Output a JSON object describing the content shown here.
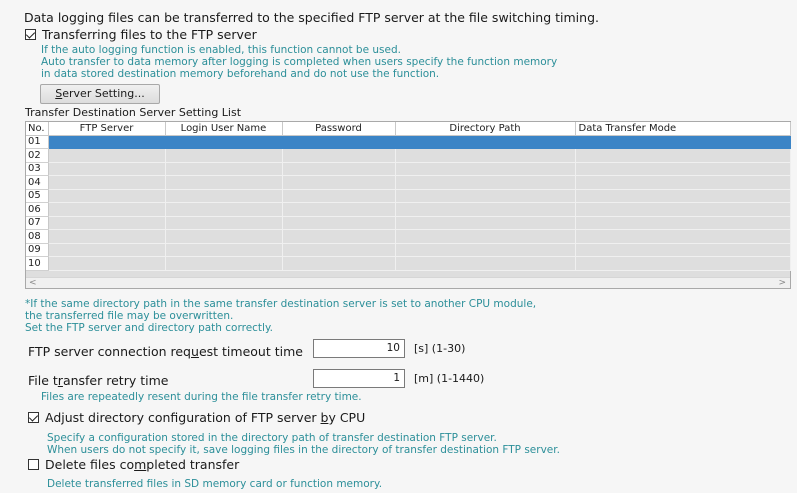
{
  "intro": "Data logging files can be transferred to the specified FTP server at the file switching timing.",
  "transfer_checkbox": {
    "checked": true,
    "label_pre": "Transferring f",
    "label_u": "i",
    "label_post": "les to the FTP server"
  },
  "notes": [
    "If the auto logging function is enabled, this function cannot be used.",
    "Auto transfer to data memory after logging is completed when users specify the function memory",
    "in data stored destination memory beforehand and do not use the function."
  ],
  "server_setting_button": {
    "u": "S",
    "rest": "erver Setting..."
  },
  "list_title": "Transfer Destination Server Setting List",
  "table": {
    "columns": [
      "No.",
      "FTP Server",
      "Login User Name",
      "Password",
      "Directory Path",
      "Data Transfer Mode"
    ],
    "rows": [
      "01",
      "02",
      "03",
      "04",
      "05",
      "06",
      "07",
      "08",
      "09",
      "10"
    ],
    "selected_row": "01"
  },
  "scroll": {
    "left": "<",
    "right": ">"
  },
  "warnings": [
    "*If the same directory path in the same transfer destination server is set to another CPU module,",
    "the transferred file may be overwritten.",
    "Set the FTP server and directory path correctly."
  ],
  "timeout": {
    "label_pre": "FTP server connection req",
    "label_u": "u",
    "label_post": "est timeout time",
    "value": "10",
    "unit": "[s] (1-30)"
  },
  "retry": {
    "label_pre": "File t",
    "label_u": "r",
    "label_post": "ansfer retry time",
    "value": "1",
    "unit": "[m] (1-1440)",
    "note": "Files are repeatedly resent during the file transfer retry time."
  },
  "adjust_checkbox": {
    "checked": true,
    "label_pre": "Adjust directory configuration of FTP server ",
    "label_u": "b",
    "label_post": "y CPU",
    "notes": [
      "Specify a configuration stored in the directory path of transfer destination FTP server.",
      "When users do not specify it, save logging files in the directory of transfer destination FTP server."
    ]
  },
  "delete_checkbox": {
    "checked": false,
    "label_pre": "Delete files co",
    "label_u": "m",
    "label_post": "pleted transfer",
    "note": "Delete transferred files in SD memory card or function memory."
  }
}
